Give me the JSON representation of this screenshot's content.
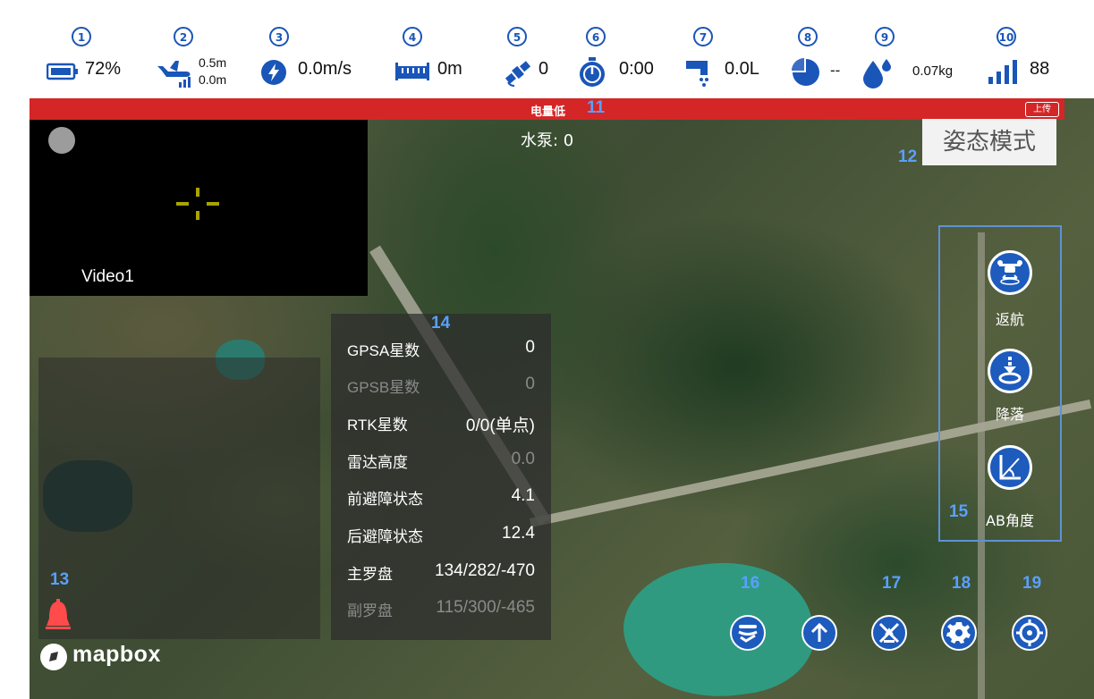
{
  "status_bar": {
    "items": [
      {
        "num": "1",
        "value": "72%"
      },
      {
        "num": "2",
        "value_top": "0.5m",
        "value_bottom": "0.0m"
      },
      {
        "num": "3",
        "value": "0.0m/s"
      },
      {
        "num": "4",
        "value": "0m"
      },
      {
        "num": "5",
        "value": "0"
      },
      {
        "num": "6",
        "value": "0:00"
      },
      {
        "num": "7",
        "value": "0.0L"
      },
      {
        "num": "8",
        "value": "--"
      },
      {
        "num": "9",
        "value": "0.07kg"
      },
      {
        "num": "10",
        "value": "88"
      }
    ],
    "accent": "#1a55b8"
  },
  "warning": {
    "text": "电量低",
    "num": "11",
    "upload": "上传",
    "color": "#d42626"
  },
  "pump": "水泵: 0",
  "mode": {
    "label": "姿态模式",
    "num": "12"
  },
  "video": {
    "label": "Video1"
  },
  "alarm": {
    "num": "13"
  },
  "info_panel": {
    "num": "14",
    "rows": [
      {
        "label": "GPSA星数",
        "value": "0"
      },
      {
        "label": "GPSB星数",
        "value": "0"
      },
      {
        "label": "RTK星数",
        "value": "0/0(单点)"
      },
      {
        "label": "雷达高度",
        "value": "0.0"
      },
      {
        "label": "前避障状态",
        "value": "4.1"
      },
      {
        "label": "后避障状态",
        "value": "12.4"
      },
      {
        "label": "主罗盘",
        "value": "134/282/-470"
      },
      {
        "label": "副罗盘",
        "value": "115/300/-465"
      }
    ]
  },
  "actions": {
    "num": "15",
    "items": [
      {
        "label": "返航",
        "icon": "drone-return-icon"
      },
      {
        "label": "降落",
        "icon": "landing-icon"
      },
      {
        "label": "AB角度",
        "icon": "ab-angle-icon"
      }
    ]
  },
  "bottom_buttons": [
    {
      "num": "16",
      "icon": "layers-icon"
    },
    {
      "num": "",
      "icon": "arrow-up-icon"
    },
    {
      "num": "17",
      "icon": "no-spray-icon"
    },
    {
      "num": "18",
      "icon": "gear-icon"
    },
    {
      "num": "19",
      "icon": "crosshair-icon"
    }
  ],
  "mapbox": {
    "label": "mapbox"
  }
}
